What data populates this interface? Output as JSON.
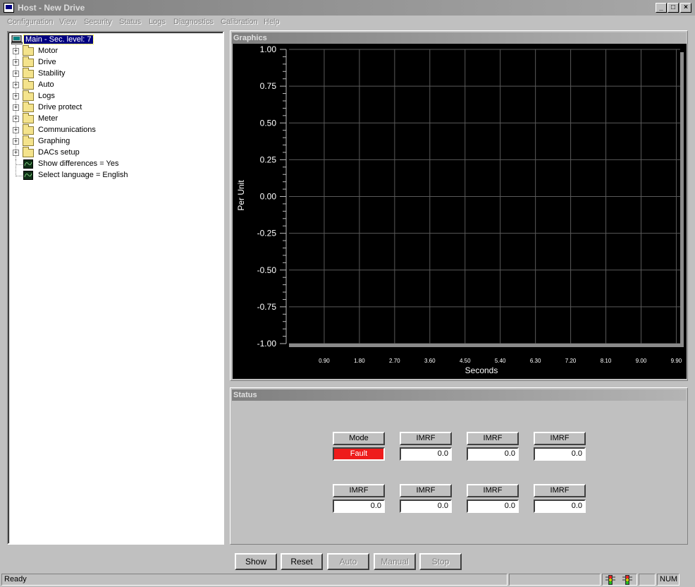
{
  "window": {
    "title": "Host - New Drive",
    "min_label": "_",
    "max_label": "□",
    "close_label": "×"
  },
  "menu": [
    "Configuration",
    "View",
    "Security",
    "Status",
    "Logs",
    "Diagnostics",
    "Calibration",
    "Help"
  ],
  "tree": {
    "root": "Main - Sec. level: 7",
    "folders": [
      "Motor",
      "Drive",
      "Stability",
      "Auto",
      "Logs",
      "Drive protect",
      "Meter",
      "Communications",
      "Graphing",
      "DACs setup"
    ],
    "settings": [
      "Show differences = Yes",
      "Select language = English"
    ],
    "expander_symbol": "+"
  },
  "graphics": {
    "header": "Graphics"
  },
  "chart_data": {
    "type": "line",
    "xlabel": "Seconds",
    "ylabel": "Per Unit",
    "ylim": [
      -1.0,
      1.0
    ],
    "xlim": [
      0,
      10
    ],
    "y_ticks": [
      "1.00",
      "0.75",
      "0.50",
      "0.25",
      "0.00",
      "-0.25",
      "-0.50",
      "-0.75",
      "-1.00"
    ],
    "y_values": [
      1.0,
      0.75,
      0.5,
      0.25,
      0.0,
      -0.25,
      -0.5,
      -0.75,
      -1.0
    ],
    "x_ticks": [
      "0.90",
      "1.80",
      "2.70",
      "3.60",
      "4.50",
      "5.40",
      "6.30",
      "7.20",
      "8.10",
      "9.00",
      "9.90"
    ],
    "x_values": [
      0.9,
      1.8,
      2.7,
      3.6,
      4.5,
      5.4,
      6.3,
      7.2,
      8.1,
      9.0,
      9.9
    ],
    "grid": true,
    "series": [],
    "colors": {
      "background": "#000000",
      "grid": "#5a5a5a",
      "text": "#ffffff"
    }
  },
  "status": {
    "header": "Status",
    "row1": [
      {
        "label": "Mode",
        "value": "Fault",
        "fault": true
      },
      {
        "label": "IMRF",
        "value": "0.0"
      },
      {
        "label": "IMRF",
        "value": "0.0"
      },
      {
        "label": "IMRF",
        "value": "0.0"
      }
    ],
    "row2": [
      {
        "label": "IMRF",
        "value": "0.0"
      },
      {
        "label": "IMRF",
        "value": "0.0"
      },
      {
        "label": "IMRF",
        "value": "0.0"
      },
      {
        "label": "IMRF",
        "value": "0.0"
      }
    ]
  },
  "buttons": [
    {
      "label": "Show",
      "enabled": true
    },
    {
      "label": "Reset",
      "enabled": true
    },
    {
      "label": "Auto",
      "enabled": false
    },
    {
      "label": "Manual",
      "enabled": false
    },
    {
      "label": "Stop",
      "enabled": false
    }
  ],
  "statusbar": {
    "text": "Ready",
    "num": "NUM"
  },
  "colors": {
    "fault": "#ee1c1c",
    "title_gradient_start": "#808080"
  }
}
